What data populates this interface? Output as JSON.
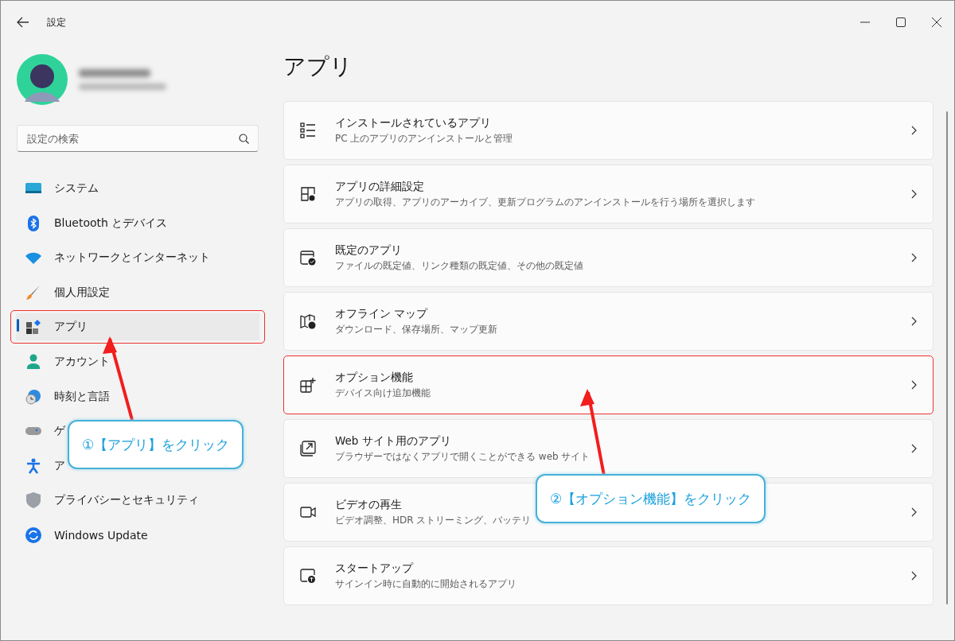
{
  "window": {
    "title": "設定"
  },
  "search": {
    "placeholder": "設定の検索"
  },
  "sidebar": {
    "items": [
      {
        "label": "システム",
        "selected": false,
        "highlighted": false
      },
      {
        "label": "Bluetooth とデバイス",
        "selected": false,
        "highlighted": false
      },
      {
        "label": "ネットワークとインターネット",
        "selected": false,
        "highlighted": false
      },
      {
        "label": "個人用設定",
        "selected": false,
        "highlighted": false
      },
      {
        "label": "アプリ",
        "selected": true,
        "highlighted": true
      },
      {
        "label": "アカウント",
        "selected": false,
        "highlighted": false
      },
      {
        "label": "時刻と言語",
        "selected": false,
        "highlighted": false
      },
      {
        "label": "ゲ",
        "selected": false,
        "highlighted": false
      },
      {
        "label": "ア",
        "selected": false,
        "highlighted": false
      },
      {
        "label": "プライバシーとセキュリティ",
        "selected": false,
        "highlighted": false
      },
      {
        "label": "Windows Update",
        "selected": false,
        "highlighted": false
      }
    ]
  },
  "page": {
    "title": "アプリ",
    "cards": [
      {
        "title": "インストールされているアプリ",
        "subtitle": "PC 上のアプリのアンインストールと管理",
        "highlighted": false
      },
      {
        "title": "アプリの詳細設定",
        "subtitle": "アプリの取得、アプリのアーカイブ、更新プログラムのアンインストールを行う場所を選択します",
        "highlighted": false
      },
      {
        "title": "既定のアプリ",
        "subtitle": "ファイルの既定値、リンク種類の既定値、その他の既定値",
        "highlighted": false
      },
      {
        "title": "オフライン マップ",
        "subtitle": "ダウンロード、保存場所、マップ更新",
        "highlighted": false
      },
      {
        "title": "オプション機能",
        "subtitle": "デバイス向け追加機能",
        "highlighted": true
      },
      {
        "title": "Web サイト用のアプリ",
        "subtitle": "ブラウザーではなくアプリで開くことができる web サイト",
        "highlighted": false
      },
      {
        "title": "ビデオの再生",
        "subtitle": "ビデオ調整、HDR ストリーミング、バッテリ",
        "highlighted": false
      },
      {
        "title": "スタートアップ",
        "subtitle": "サインイン時に自動的に開始されるアプリ",
        "highlighted": false
      }
    ]
  },
  "callouts": [
    {
      "text": "①【アプリ】をクリック"
    },
    {
      "text": "②【オプション機能】をクリック"
    }
  ]
}
